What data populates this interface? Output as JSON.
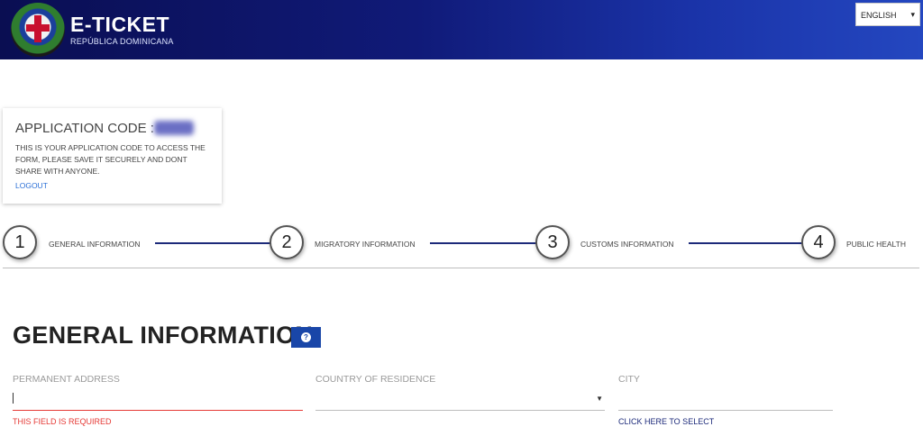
{
  "header": {
    "title": "E-TICKET",
    "subtitle": "REPÚBLICA DOMINICANA",
    "language": "ENGLISH",
    "colors": {
      "header_dark": "#0a0e52",
      "header_light": "#2447c0"
    }
  },
  "application": {
    "code_label": "APPLICATION CODE :",
    "description": "THIS IS YOUR APPLICATION CODE TO ACCESS THE FORM, PLEASE SAVE IT SECURELY AND DONT SHARE WITH ANYONE.",
    "logout": "LOGOUT"
  },
  "steps": [
    {
      "number": "1",
      "label": "GENERAL INFORMATION"
    },
    {
      "number": "2",
      "label": "MIGRATORY INFORMATION"
    },
    {
      "number": "3",
      "label": "CUSTOMS INFORMATION"
    },
    {
      "number": "4",
      "label": "PUBLIC HEALTH"
    }
  ],
  "section": {
    "title": "GENERAL INFORMATION",
    "help_icon": "question-icon",
    "help_glyph": "?"
  },
  "fields": {
    "permanent_address": {
      "label": "PERMANENT ADDRESS",
      "value": "",
      "error": "THIS FIELD IS REQUIRED"
    },
    "country_of_residence": {
      "label": "COUNTRY OF RESIDENCE",
      "value": ""
    },
    "city": {
      "label": "CITY",
      "value": "",
      "link": "CLICK HERE TO SELECT"
    }
  },
  "colors": {
    "accent": "#1946a8",
    "error": "#e53935",
    "link": "#2a6fd6"
  }
}
